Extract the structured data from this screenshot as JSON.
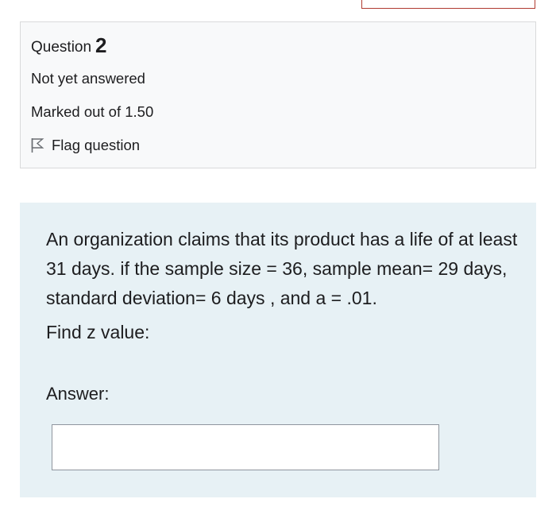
{
  "question": {
    "heading_label": "Question",
    "number": "2",
    "state": "Not yet answered",
    "grade": "Marked out of 1.50",
    "flag_label": "Flag question",
    "flag_icon": "flag-outline-icon"
  },
  "content": {
    "text": "An organization claims that its product has a life of at least 31 days. if  the sample size = 36, sample mean= 29 days, standard deviation= 6 days , and a = .01.",
    "prompt": "Find z value:",
    "answer_label": "Answer:",
    "answer_value": ""
  },
  "colors": {
    "info_background": "#f8f9fa",
    "content_background": "#e7f1f5",
    "previous_box_border": "#b03a30"
  }
}
